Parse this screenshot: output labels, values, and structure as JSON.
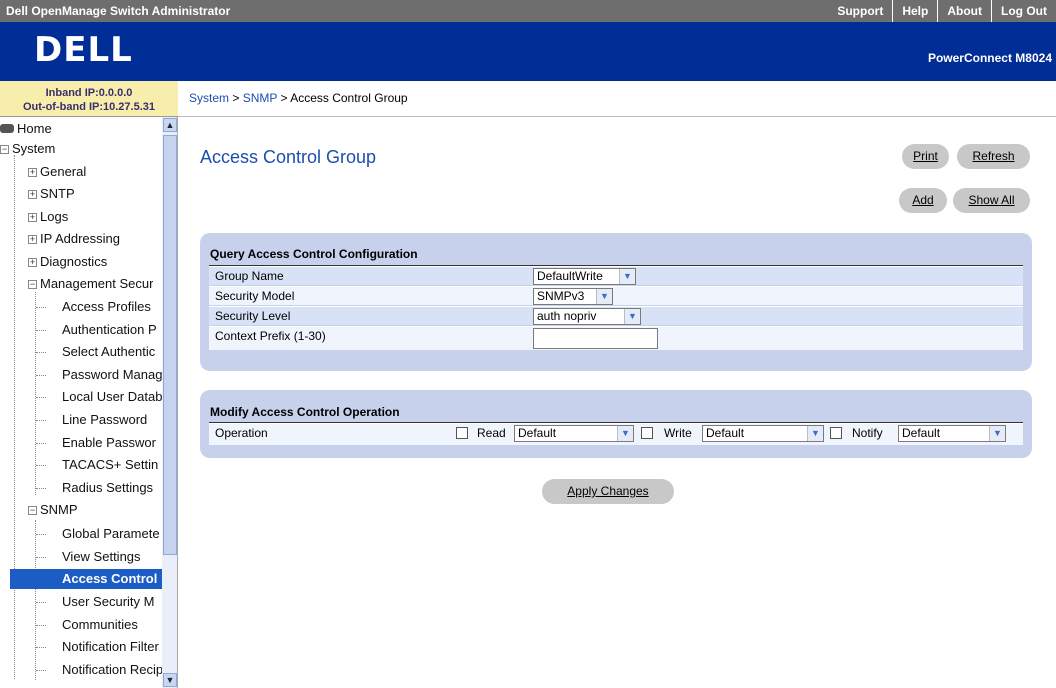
{
  "topbar": {
    "title": "Dell OpenManage Switch Administrator",
    "links": [
      "Support",
      "Help",
      "About",
      "Log Out"
    ]
  },
  "header": {
    "logo": "DELL",
    "product": "PowerConnect M8024"
  },
  "ipinfo": {
    "inband": "Inband IP:0.0.0.0",
    "outofband": "Out-of-band IP:10.27.5.31"
  },
  "breadcrumb": {
    "system": "System",
    "snmp": "SNMP",
    "current": "Access Control Group",
    "sep": ">"
  },
  "nav": {
    "home": "Home",
    "system": "System",
    "general": "General",
    "sntp": "SNTP",
    "logs": "Logs",
    "ip_addressing": "IP Addressing",
    "diagnostics": "Diagnostics",
    "management_security": "Management Secur",
    "access_profiles": "Access Profiles",
    "authentication_p": "Authentication P",
    "select_authentic": "Select Authentic",
    "password_manag": "Password Manag",
    "local_user_datab": "Local User Datab",
    "line_password": "Line Password",
    "enable_password": "Enable Passwor",
    "tacacs_settings": "TACACS+ Settin",
    "radius_settings": "Radius Settings",
    "snmp": "SNMP",
    "global_parameters": "Global Paramete",
    "view_settings": "View Settings",
    "access_control": "Access Control",
    "user_security_model": "User Security M",
    "communities": "Communities",
    "notification_filter": "Notification Filter",
    "notification_recip": "Notification Recip"
  },
  "main": {
    "title": "Access Control Group",
    "print": "Print",
    "refresh": "Refresh",
    "add": "Add",
    "show_all": "Show All",
    "query_panel": {
      "title": "Query Access Control Configuration",
      "group_name_label": "Group Name",
      "group_name_value": "DefaultWrite",
      "security_model_label": "Security Model",
      "security_model_value": "SNMPv3",
      "security_level_label": "Security Level",
      "security_level_value": "auth nopriv",
      "context_prefix_label": "Context Prefix (1-30)",
      "context_prefix_value": ""
    },
    "modify_panel": {
      "title": "Modify Access Control Operation",
      "operation_label": "Operation",
      "read_label": "Read",
      "read_value": "Default",
      "write_label": "Write",
      "write_value": "Default",
      "notify_label": "Notify",
      "notify_value": "Default"
    },
    "apply": "Apply Changes"
  },
  "colors": {
    "topbar": "#6e6e6e",
    "header": "#012d96",
    "panel": "#c7d1ec",
    "link": "#1b4fae",
    "selected_nav": "#1c5cc5",
    "ip_bg": "#f6eeaa"
  }
}
